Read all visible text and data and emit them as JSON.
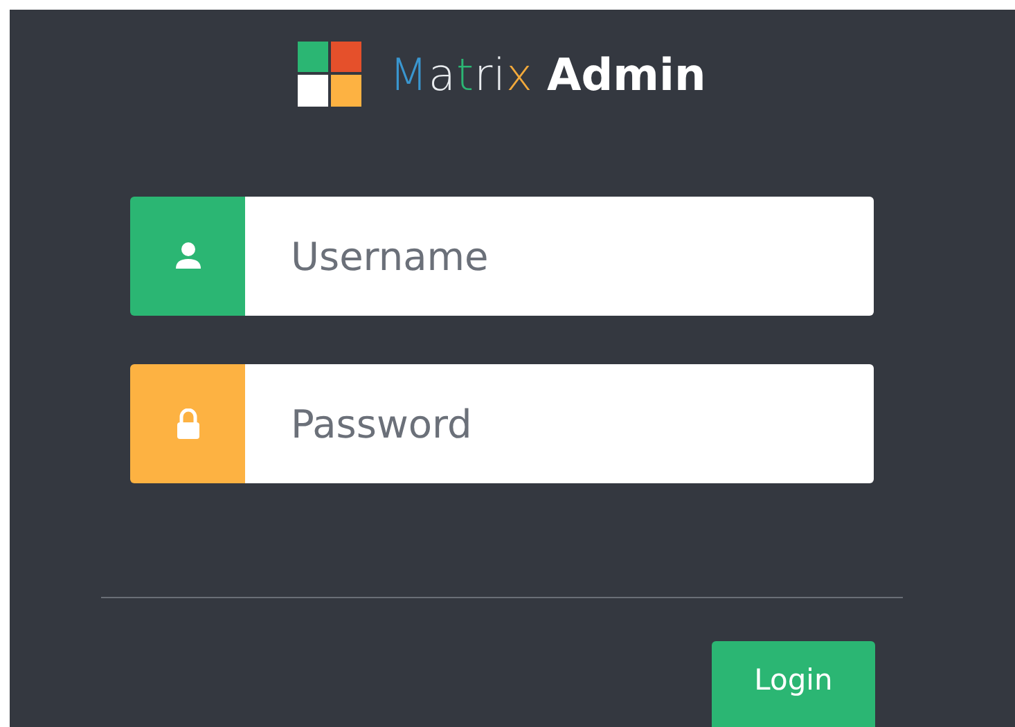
{
  "logo": {
    "name": "Matrix",
    "name_bold": "Admin"
  },
  "fields": [
    {
      "kind": "user",
      "color": "#2bb673",
      "placeholder": "Username"
    },
    {
      "kind": "lock",
      "color": "#fdb242",
      "placeholder": "Password"
    }
  ],
  "login_button": "Login"
}
